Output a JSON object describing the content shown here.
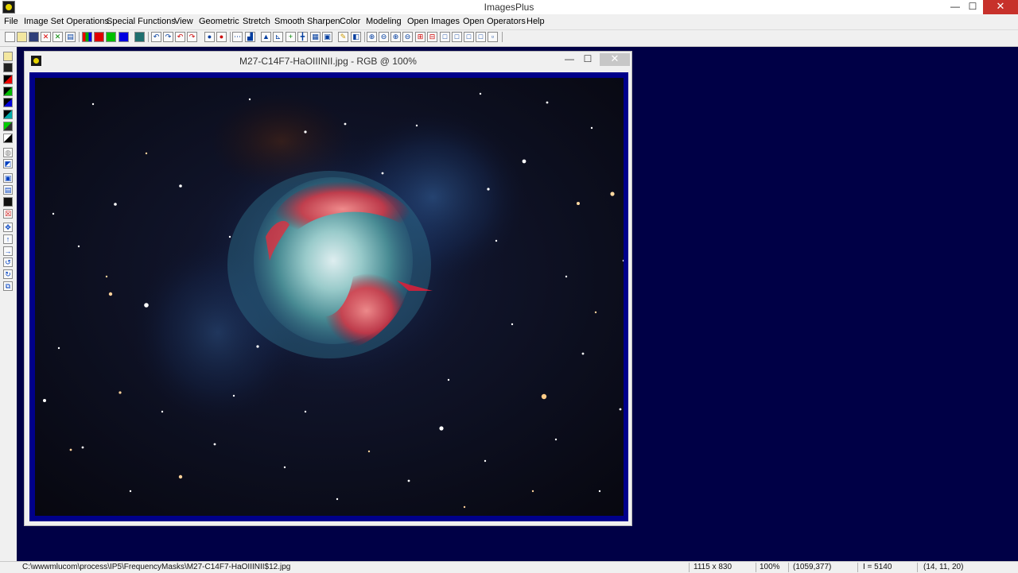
{
  "app": {
    "title": "ImagesPlus"
  },
  "window_controls": {
    "minimize": "—",
    "maximize": "☐",
    "close": "✕"
  },
  "menu": {
    "items": [
      {
        "label": "File"
      },
      {
        "label": "Image Set Operations"
      },
      {
        "label": "Special Functions"
      },
      {
        "label": "View"
      },
      {
        "label": "Geometric"
      },
      {
        "label": "Stretch"
      },
      {
        "label": "Smooth Sharpen"
      },
      {
        "label": "Color"
      },
      {
        "label": "Modeling"
      },
      {
        "label": "Open Images"
      },
      {
        "label": "Open Operators"
      },
      {
        "label": "Help"
      }
    ]
  },
  "toolbar": {
    "icons": [
      "new-icon",
      "open-icon",
      "save-icon",
      "close-red-icon",
      "close-green-icon",
      "settings-icon",
      "rgb-channels-icon",
      "red-channel-icon",
      "green-channel-icon",
      "blue-channel-icon",
      "mono-icon",
      "undo-icon",
      "redo-icon",
      "undo-all-icon",
      "redo-all-icon",
      "dot-black-icon",
      "dot-red-icon",
      "line-select-icon",
      "histogram-icon",
      "crop-icon",
      "scale-icon",
      "cross-icon",
      "align-icon",
      "frame-icon",
      "camera-icon",
      "pen-icon",
      "window-icon",
      "zoom-in-icon",
      "zoom-out-icon",
      "zoom-fit-icon",
      "zoom-100-icon",
      "zoom-rect-icon",
      "zoom-rect-2-icon",
      "frame-a-icon",
      "frame-b-icon",
      "frame-c-icon",
      "frame-d-icon",
      "frame-e-icon"
    ]
  },
  "image_window": {
    "title": "M27-C14F7-HaOIIINII.jpg - RGB @ 100%",
    "minimize": "—",
    "maximize": "☐",
    "close": "✕"
  },
  "status": {
    "path": "C:\\wwwmlucom\\process\\IP5\\FrequencyMasks\\M27-C14F7-HaOIIINII$12.jpg",
    "dimensions": "1115 x 830",
    "zoom": "100%",
    "coords": "(1059,377)",
    "intensity": "I = 5140",
    "rgb": "(14, 11, 20)"
  },
  "colors": {
    "workspace_bg": "#000046",
    "image_border": "#00008a",
    "close_button": "#c7312b"
  }
}
